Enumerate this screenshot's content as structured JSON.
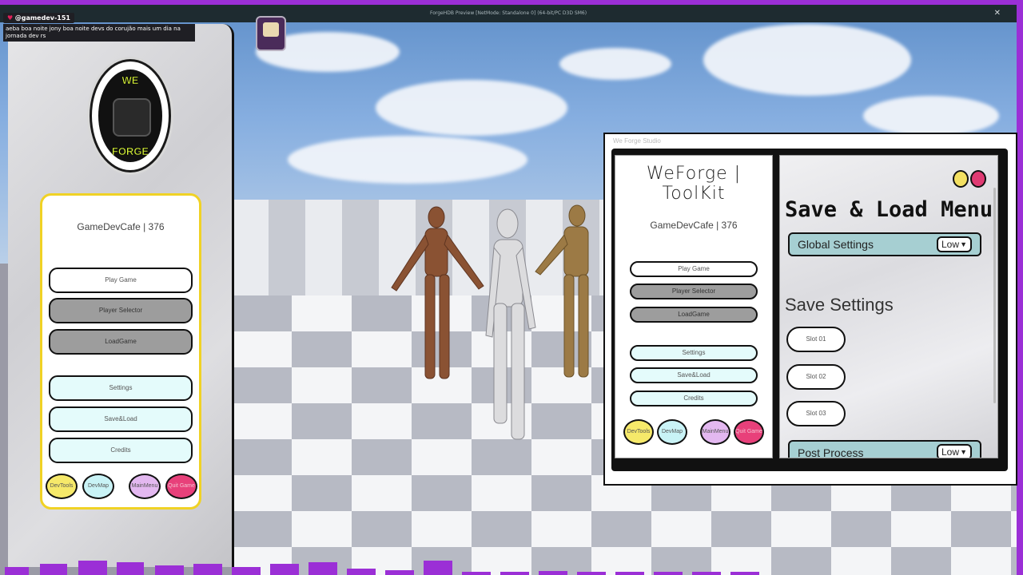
{
  "window": {
    "title": "ForgeHDB Preview [NetMode: Standalone 0] (64-bit/PC D3D SM6)",
    "close_glyph": "✕"
  },
  "chat": {
    "username": "@gamedev-151",
    "message": "aeba boa noite jony boa noite devs do corujão mais um dia na jornada dev rs"
  },
  "logo": {
    "line1": "WE",
    "line2": "FORGE"
  },
  "left_panel": {
    "title": "GameDevCafe | 376",
    "buttons": [
      "Play Game",
      "Player Selector",
      "LoadGame",
      "Settings",
      "Save&Load",
      "Credits"
    ],
    "round_buttons": [
      "DevTools",
      "DevMap",
      "MainMenu",
      "Quit Game"
    ]
  },
  "toolkit": {
    "caption": "We Forge Studio",
    "brand": "WeForge | ToolKit",
    "title": "GameDevCafe | 376",
    "buttons": [
      "Play Game",
      "Player Selector",
      "LoadGame",
      "Settings",
      "Save&Load",
      "Credits"
    ],
    "round_buttons": [
      "DevTools",
      "DevMap",
      "MainMenu",
      "Quit Game"
    ]
  },
  "save_menu": {
    "title": "Save & Load Menu",
    "global_settings_label": "Global Settings",
    "global_settings_value": "Low",
    "save_settings_label": "Save Settings",
    "slots": [
      "Slot 01",
      "Slot 02",
      "Slot 03"
    ],
    "post_process_label": "Post Process",
    "post_process_value": "Low"
  },
  "colors": {
    "accent_purple": "#9b2fd6",
    "card_border_yellow": "#f0d225",
    "settings_row": "#a6cfd2",
    "quit_pink": "#e8407a"
  }
}
